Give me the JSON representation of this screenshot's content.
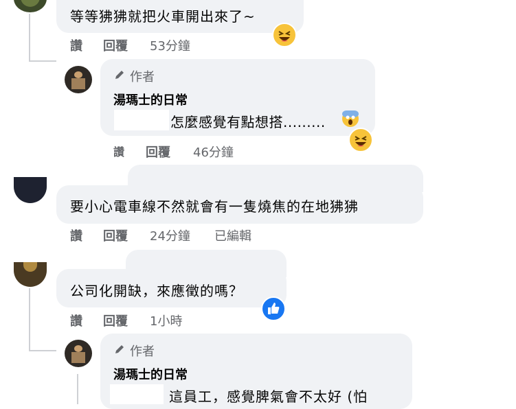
{
  "comments": [
    {
      "text": "等等狒狒就把火車開出來了~",
      "actions": {
        "like": "讚",
        "reply": "回覆",
        "time": "53分鐘"
      },
      "reaction": "laughing-emoji"
    },
    {
      "author_badge": "作者",
      "author_name": "湯瑪士的日常",
      "text": "怎麼感覺有點想搭.........",
      "inline_emoji": "scream-emoji",
      "actions": {
        "like": "讚",
        "reply": "回覆",
        "time": "46分鐘"
      },
      "reaction": "laughing-emoji"
    },
    {
      "text": "要小心電車線不然就會有一隻燒焦的在地狒狒",
      "actions": {
        "like": "讚",
        "reply": "回覆",
        "time": "24分鐘",
        "edited": "已編輯"
      }
    },
    {
      "text": "公司化開缺，來應徵的嗎？",
      "actions": {
        "like": "讚",
        "reply": "回覆",
        "time": "1小時"
      },
      "reaction": "thumbs-up"
    },
    {
      "author_badge": "作者",
      "author_name": "湯瑪士的日常",
      "text": "這員工，感覺脾氣會不太好 (怕"
    }
  ],
  "colors": {
    "bubble": "#f0f2f5",
    "meta": "#65676b",
    "text": "#050505",
    "like_blue": "#1877f2",
    "emoji_yellow": "#f7c33a"
  }
}
